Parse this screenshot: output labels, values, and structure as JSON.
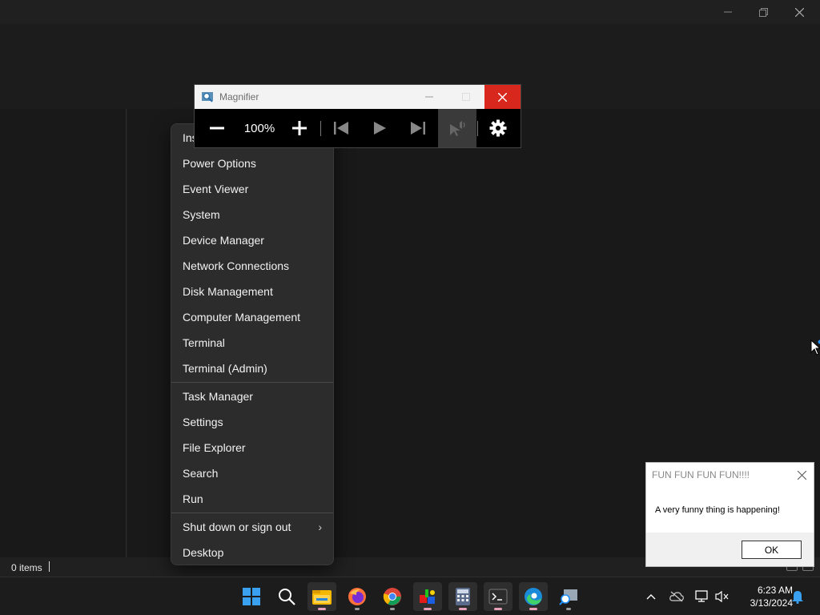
{
  "explorer": {
    "status_count": "0 items"
  },
  "context_menu": {
    "items": [
      {
        "label": "Ins"
      },
      {
        "label": "Power Options"
      },
      {
        "label": "Event Viewer"
      },
      {
        "label": "System"
      },
      {
        "label": "Device Manager"
      },
      {
        "label": "Network Connections"
      },
      {
        "label": "Disk Management"
      },
      {
        "label": "Computer Management"
      },
      {
        "label": "Terminal"
      },
      {
        "label": "Terminal (Admin)"
      },
      {
        "label": "Task Manager"
      },
      {
        "label": "Settings"
      },
      {
        "label": "File Explorer"
      },
      {
        "label": "Search"
      },
      {
        "label": "Run"
      },
      {
        "label": "Shut down or sign out",
        "submenu": true
      },
      {
        "label": "Desktop"
      }
    ]
  },
  "magnifier": {
    "title": "Magnifier",
    "zoom": "100%"
  },
  "dialog": {
    "title": "FUN FUN FUN FUN!!!!",
    "message": "A very funny thing is happening!",
    "ok_label": "OK"
  },
  "taskbar": {
    "apps": [
      {
        "name": "start-icon"
      },
      {
        "name": "search-icon"
      },
      {
        "name": "file-explorer-icon"
      },
      {
        "name": "firefox-icon"
      },
      {
        "name": "chrome-icon"
      },
      {
        "name": "paint-app-icon"
      },
      {
        "name": "calculator-icon"
      },
      {
        "name": "terminal-icon"
      },
      {
        "name": "edge-icon"
      },
      {
        "name": "magnifier-icon"
      }
    ],
    "time": "6:23 AM",
    "date": "3/13/2024"
  },
  "colors": {
    "close_red": "#d8271d",
    "menu_bg": "#2c2c2c",
    "taskbar_bg": "#1c1c1c",
    "accent_blue": "#0078d4"
  }
}
